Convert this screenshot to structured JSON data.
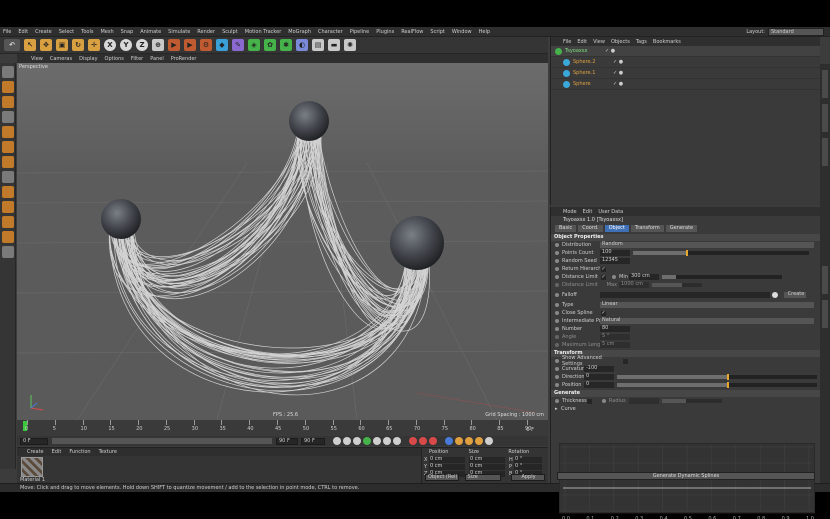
{
  "menubar": {
    "items": [
      "File",
      "Edit",
      "Create",
      "Select",
      "Tools",
      "Mesh",
      "Snap",
      "Animate",
      "Simulate",
      "Render",
      "Sculpt",
      "Motion Tracker",
      "MoGraph",
      "Character",
      "Pipeline",
      "Plugins",
      "RealFlow",
      "Script",
      "Window",
      "Help"
    ],
    "layout_label": "Layout:",
    "layout_value": "Standard"
  },
  "toolbar": {
    "axis_x": "X",
    "axis_y": "Y",
    "axis_z": "Z"
  },
  "viewport": {
    "menu": [
      "View",
      "Cameras",
      "Display",
      "Options",
      "Filter",
      "Panel",
      "ProRender"
    ],
    "label": "Perspective",
    "fps": "FPS : 25.6",
    "grid_spacing": "Grid Spacing : 1000 cm"
  },
  "timeline": {
    "ticks": [
      "0",
      "5",
      "10",
      "15",
      "20",
      "25",
      "30",
      "35",
      "40",
      "45",
      "50",
      "55",
      "60",
      "65",
      "70",
      "75",
      "80",
      "85",
      "90"
    ],
    "current_frame": "0 F",
    "start_frame": "0 F",
    "end_frame": "90 F",
    "preview_end": "90 F"
  },
  "material": {
    "menu": [
      "Create",
      "Edit",
      "Function",
      "Texture"
    ],
    "mat_label": "Material 1"
  },
  "coords": {
    "headers": [
      "Position",
      "Size",
      "Rotation"
    ],
    "rows": [
      {
        "axis": "X",
        "pos": "0 cm",
        "size": "0 cm",
        "rot_axis": "H",
        "rot": "0 °"
      },
      {
        "axis": "Y",
        "pos": "0 cm",
        "size": "0 cm",
        "rot_axis": "P",
        "rot": "0 °"
      },
      {
        "axis": "Z",
        "pos": "0 cm",
        "size": "0 cm",
        "rot_axis": "B",
        "rot": "0 °"
      }
    ],
    "mode": "Object (Rel)",
    "size_mode": "Size",
    "apply": "Apply"
  },
  "status": "Move: Click and drag to move elements. Hold down SHIFT to quantize movement / add to the selection in point mode, CTRL to remove.",
  "objects": {
    "menu": [
      "File",
      "Edit",
      "View",
      "Objects",
      "Tags",
      "Bookmarks"
    ],
    "items": [
      {
        "name": "Tsyoaxsx",
        "main": true
      },
      {
        "name": "Sphere.2",
        "main": false
      },
      {
        "name": "Sphere.1",
        "main": false
      },
      {
        "name": "Sphere",
        "main": false
      }
    ],
    "flags": "✓ ●"
  },
  "attributes": {
    "menu": [
      "Mode",
      "Edit",
      "User Data"
    ],
    "title": "Tsyoaxsx 1.0 [Tsyoaxsx]",
    "tabs": [
      {
        "label": "Basic",
        "active": false
      },
      {
        "label": "Coord.",
        "active": false
      },
      {
        "label": "Object",
        "active": true
      },
      {
        "label": "Transform",
        "active": false
      },
      {
        "label": "Generate",
        "active": false
      }
    ],
    "object_section": "Object Properties",
    "distribution_label": "Distribution",
    "distribution_value": "Random",
    "points_count_label": "Points Count",
    "points_count": "100",
    "points_fill": 0.3,
    "random_seed_label": "Random Seed",
    "random_seed": "12345",
    "return_label": "Return Hierarchy",
    "distance_label": "Distance Limit",
    "min_label": "Min",
    "min_value": "300 cm",
    "distance_limit2_label": "Distance Limit",
    "max_label": "Max",
    "max_value": "1000 cm",
    "falloff_label": "Falloff",
    "create_label": "Create",
    "type_label": "Type",
    "type_value": "Linear",
    "close_label": "Close Spline",
    "inter_label": "Intermediate Points",
    "inter_value": "Natural",
    "number_label": "Number",
    "number_value": "80",
    "angle_label": "Angle",
    "angle_value": "5 °",
    "maxlen_label": "Maximum Length",
    "maxlen_value": "5 cm",
    "transform_section": "Transform",
    "show_adv_label": "Show Advanced Settings",
    "curvature_label": "Curvature",
    "curvature_value": "-100",
    "direction_label": "Direction",
    "direction_value": "0",
    "direction_fill": 0.55,
    "position_label": "Position",
    "position_value": "0",
    "position_fill": 0.55,
    "generate_section": "Generate",
    "thickness_label": "Thickness",
    "radius_label": "Radius",
    "curve_label": "Curve",
    "curve_ticks": [
      "0.0",
      "0.1",
      "0.2",
      "0.3",
      "0.4",
      "0.5",
      "0.6",
      "0.7",
      "0.8",
      "0.9",
      "1.0"
    ],
    "gen_button": "Generate Dynamic Splines"
  }
}
